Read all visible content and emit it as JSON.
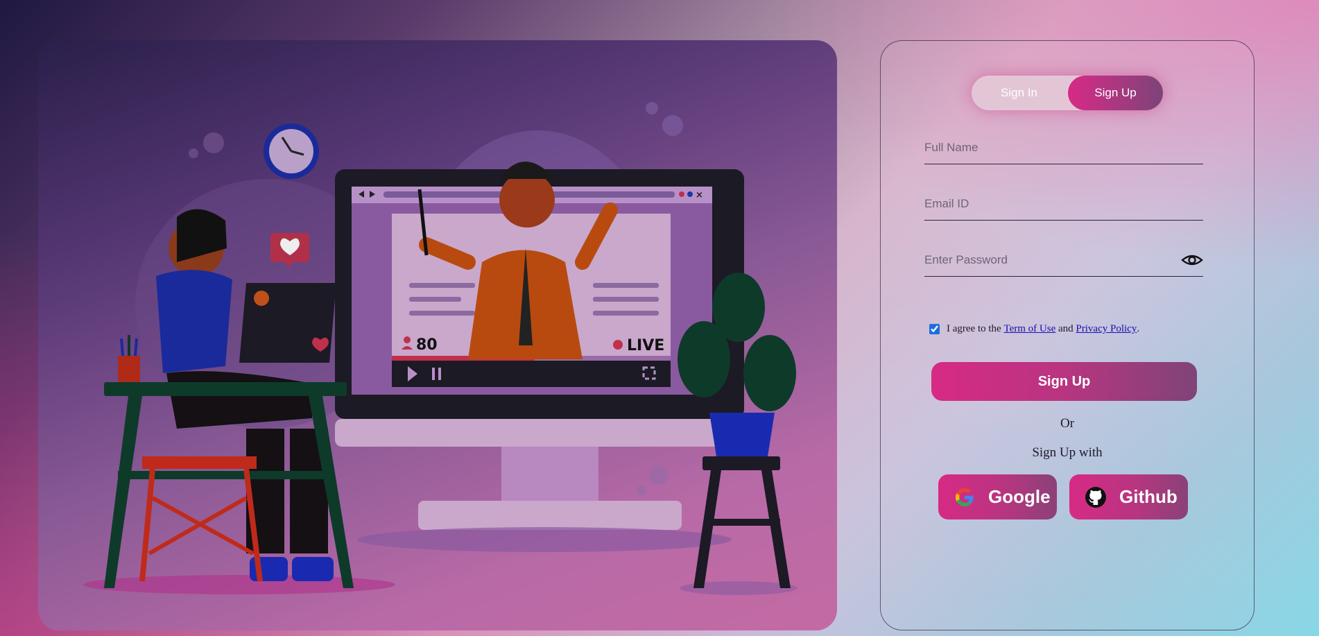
{
  "toggle": {
    "signin_label": "Sign In",
    "signup_label": "Sign Up",
    "active": "Sign Up"
  },
  "form": {
    "fullname_placeholder": "Full Name",
    "email_placeholder": "Email ID",
    "password_placeholder": "Enter Password",
    "agree_prefix": "I agree to the",
    "terms_link": "Term of Use",
    "agree_and": "and",
    "privacy_link": "Privacy Policy",
    "agree_suffix": ".",
    "agree_checked": true,
    "submit_label": "Sign Up",
    "or_text": "Or",
    "signup_with_text": "Sign Up with"
  },
  "social": {
    "google_label": "Google",
    "github_label": "Github"
  },
  "illustration": {
    "viewer_count": "80",
    "live_label": "LIVE"
  },
  "colors": {
    "accent_pink": "#d72a85",
    "accent_purple": "#7f4478"
  }
}
